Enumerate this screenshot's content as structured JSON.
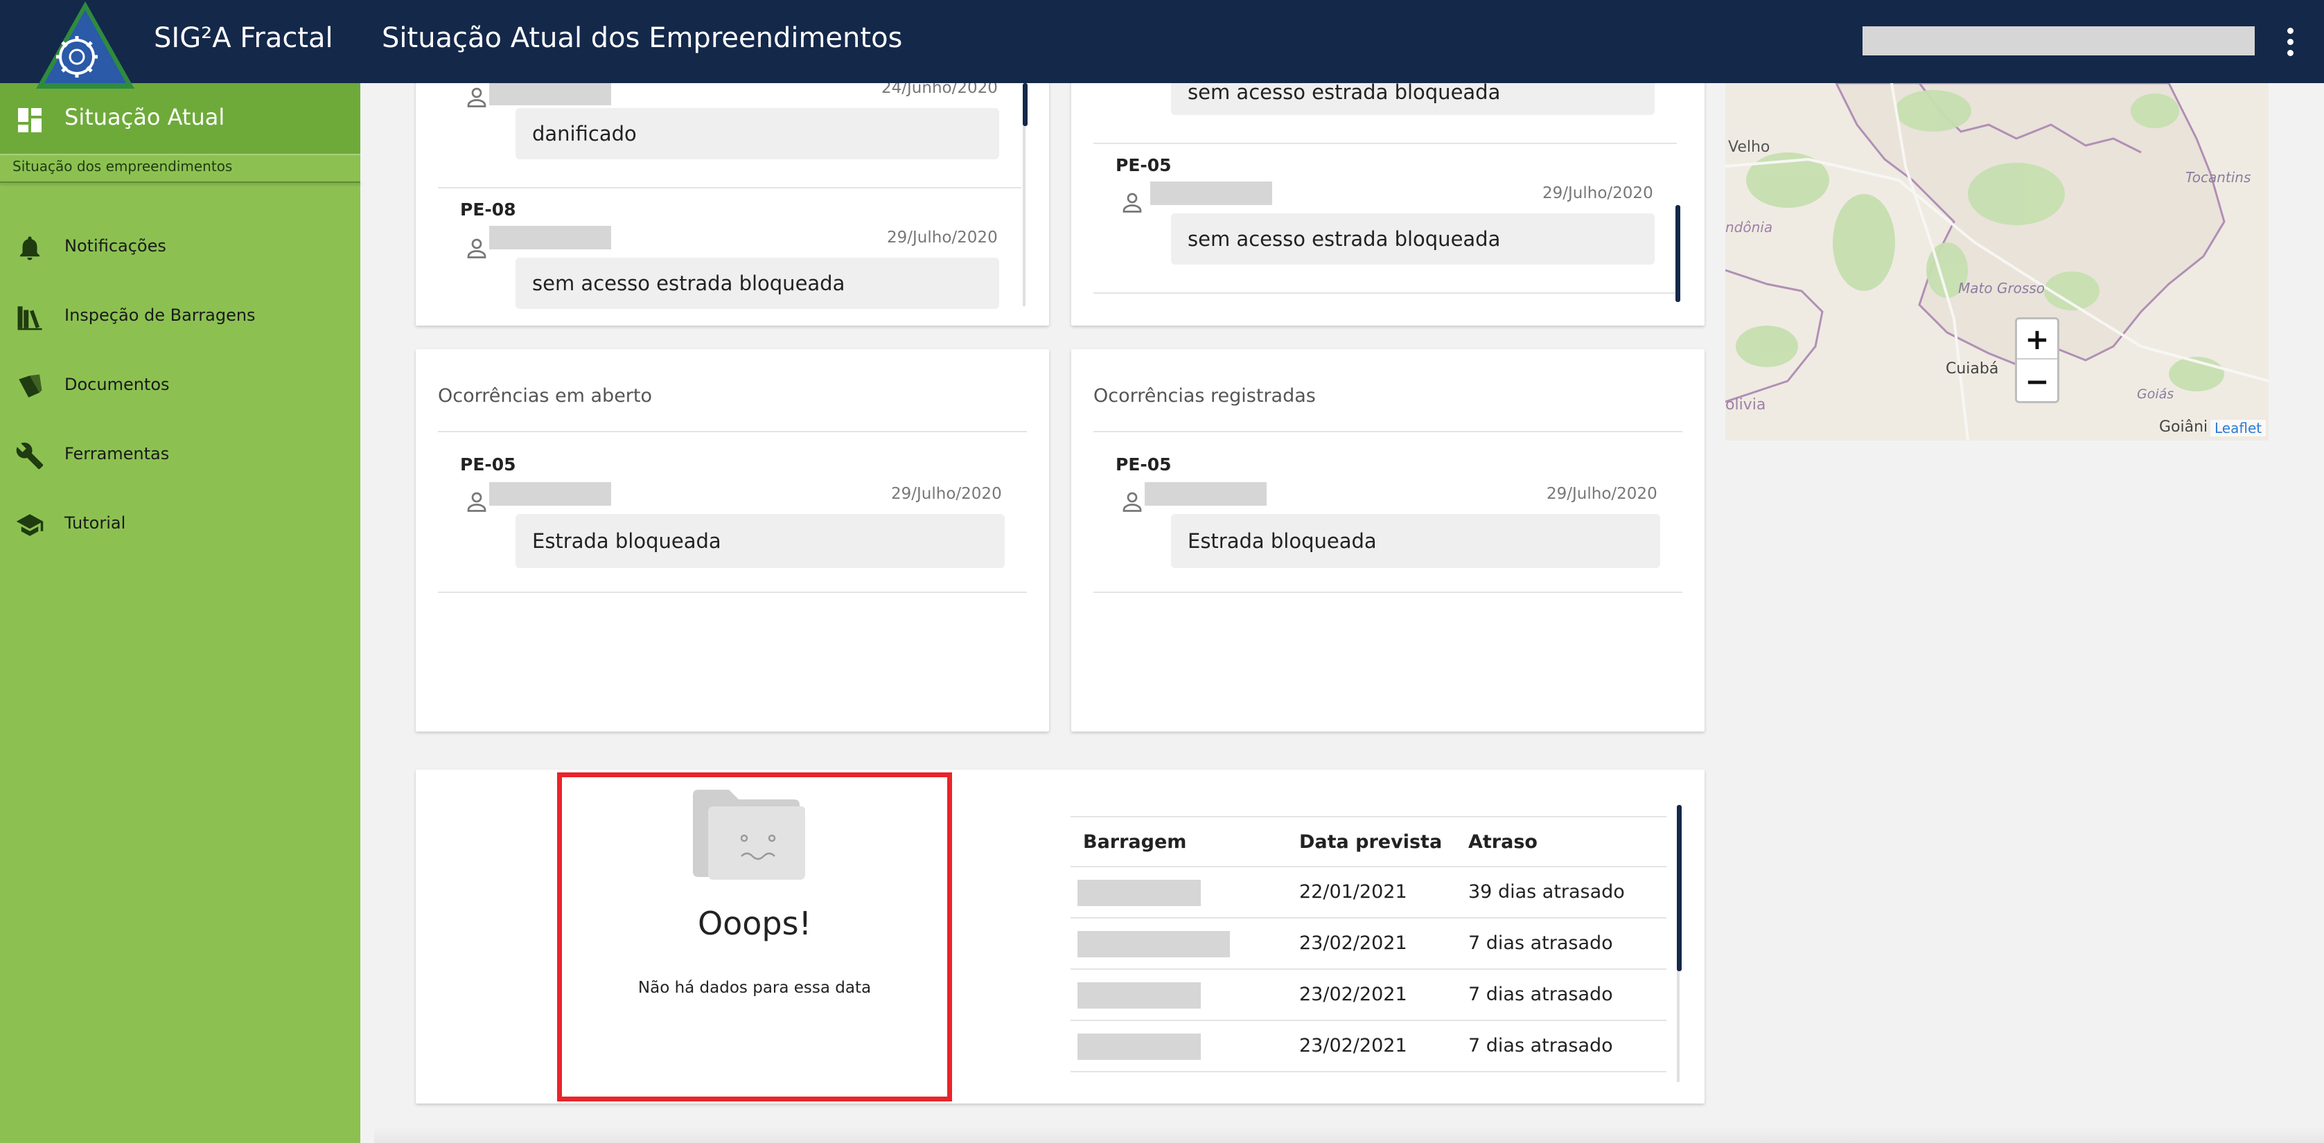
{
  "header": {
    "app_name": "SIG²A Fractal",
    "page_title": "Situação Atual dos Empreendimentos"
  },
  "sidebar": {
    "section_title": "Situação Atual",
    "section_subtitle": "Situação dos empreendimentos",
    "items": [
      {
        "label": "Notificações",
        "icon": "bell-icon"
      },
      {
        "label": "Inspeção de Barragens",
        "icon": "books-icon"
      },
      {
        "label": "Documentos",
        "icon": "document-icon"
      },
      {
        "label": "Ferramentas",
        "icon": "wrench-icon"
      },
      {
        "label": "Tutorial",
        "icon": "graduation-cap-icon"
      }
    ]
  },
  "top_left_card": {
    "entries": [
      {
        "code": "",
        "date": "24/Junho/2020",
        "message": "danificado"
      },
      {
        "code": "PE-08",
        "date": "29/Julho/2020",
        "message": "sem acesso estrada bloqueada"
      }
    ]
  },
  "top_right_card": {
    "entries": [
      {
        "code": "",
        "date": "",
        "message": "sem acesso estrada bloqueada"
      },
      {
        "code": "PE-05",
        "date": "29/Julho/2020",
        "message": "sem acesso estrada bloqueada"
      }
    ]
  },
  "open_occurrences": {
    "title": "Ocorrências em aberto",
    "entries": [
      {
        "code": "PE-05",
        "date": "29/Julho/2020",
        "message": "Estrada bloqueada"
      }
    ]
  },
  "registered_occurrences": {
    "title": "Ocorrências registradas",
    "entries": [
      {
        "code": "PE-05",
        "date": "29/Julho/2020",
        "message": "Estrada bloqueada"
      }
    ]
  },
  "empty_state": {
    "title": "Ooops!",
    "message": "Não há dados para essa data",
    "highlight_color": "#e8242a"
  },
  "schedule_table": {
    "columns": [
      "Barragem",
      "Data prevista",
      "Atraso"
    ],
    "rows": [
      {
        "date": "22/01/2021",
        "delay": "39 dias atrasado"
      },
      {
        "date": "23/02/2021",
        "delay": "7 dias atrasado"
      },
      {
        "date": "23/02/2021",
        "delay": "7 dias atrasado"
      },
      {
        "date": "23/02/2021",
        "delay": "7 dias atrasado"
      }
    ]
  },
  "map": {
    "labels": [
      "Velho",
      "ndônia",
      "Tocantins",
      "Mato Grosso",
      "Cuiabá",
      "olivia",
      "Goiás",
      "Goiâni"
    ],
    "zoom_in": "+",
    "zoom_out": "−",
    "attribution": "Leaflet"
  },
  "colors": {
    "header_bg": "#14284a",
    "sidebar_bg": "#8cc152",
    "sidebar_active": "#6eaa3a",
    "accent_scroll": "#14284a"
  }
}
